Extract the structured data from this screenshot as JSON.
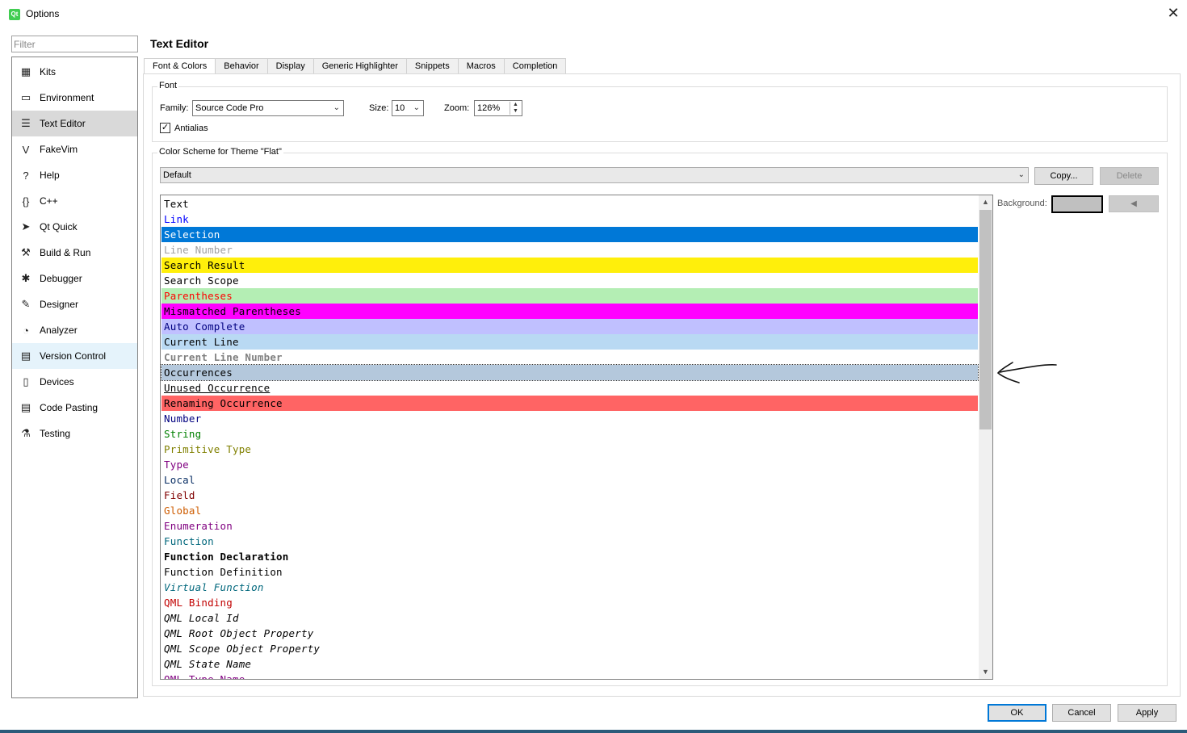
{
  "window": {
    "title": "Options",
    "app_icon_text": "Qt",
    "close_glyph": "✕"
  },
  "filter": {
    "placeholder": "Filter"
  },
  "sidebar": {
    "items": [
      {
        "label": "Kits",
        "icon": "kits-icon",
        "glyph": "▦"
      },
      {
        "label": "Environment",
        "icon": "monitor-icon",
        "glyph": "▭"
      },
      {
        "label": "Text Editor",
        "icon": "text-editor-icon",
        "glyph": "☰",
        "selected": true
      },
      {
        "label": "FakeVim",
        "icon": "fakevim-icon",
        "glyph": "V"
      },
      {
        "label": "Help",
        "icon": "help-icon",
        "glyph": "?"
      },
      {
        "label": "C++",
        "icon": "braces-icon",
        "glyph": "{}"
      },
      {
        "label": "Qt Quick",
        "icon": "paper-plane-icon",
        "glyph": "➤"
      },
      {
        "label": "Build & Run",
        "icon": "hammer-icon",
        "glyph": "⚒"
      },
      {
        "label": "Debugger",
        "icon": "bug-icon",
        "glyph": "✱"
      },
      {
        "label": "Designer",
        "icon": "pen-icon",
        "glyph": "✎"
      },
      {
        "label": "Analyzer",
        "icon": "analyzer-icon",
        "glyph": "◔"
      },
      {
        "label": "Version Control",
        "icon": "version-control-icon",
        "glyph": "▤",
        "hover": true
      },
      {
        "label": "Devices",
        "icon": "devices-icon",
        "glyph": "▯"
      },
      {
        "label": "Code Pasting",
        "icon": "code-pasting-icon",
        "glyph": "▤"
      },
      {
        "label": "Testing",
        "icon": "testing-icon",
        "glyph": "⚗"
      }
    ]
  },
  "page": {
    "title": "Text Editor"
  },
  "tabs": [
    {
      "label": "Font & Colors",
      "active": true
    },
    {
      "label": "Behavior"
    },
    {
      "label": "Display"
    },
    {
      "label": "Generic Highlighter"
    },
    {
      "label": "Snippets"
    },
    {
      "label": "Macros"
    },
    {
      "label": "Completion"
    }
  ],
  "font_group": {
    "title": "Font",
    "family_label": "Family:",
    "family_value": "Source Code Pro",
    "size_label": "Size:",
    "size_value": "10",
    "zoom_label": "Zoom:",
    "zoom_value": "126%",
    "antialias_label": "Antialias",
    "antialias_checked": true
  },
  "scheme_group": {
    "title": "Color Scheme for Theme \"Flat\"",
    "scheme_value": "Default",
    "copy_label": "Copy...",
    "delete_label": "Delete",
    "background_label": "Background:",
    "background_color": "#c0c0c0"
  },
  "scheme_items": [
    {
      "label": "Text",
      "fg": "#000000"
    },
    {
      "label": "Link",
      "fg": "#0000ff"
    },
    {
      "label": "Selection",
      "fg": "#ffffff",
      "bg": "#0078d7"
    },
    {
      "label": "Line Number",
      "fg": "#a0a0a0"
    },
    {
      "label": "Search Result",
      "fg": "#000000",
      "bg": "#ffef0b"
    },
    {
      "label": "Search Scope",
      "fg": "#000000"
    },
    {
      "label": "Parentheses",
      "fg": "#ff0000",
      "bg": "#b4eeb4"
    },
    {
      "label": "Mismatched Parentheses",
      "fg": "#000000",
      "bg": "#ff00ff"
    },
    {
      "label": "Auto Complete",
      "fg": "#000080",
      "bg": "#c0c0ff"
    },
    {
      "label": "Current Line",
      "fg": "#000000",
      "bg": "#b9d9f3"
    },
    {
      "label": "Current Line Number",
      "fg": "#808080",
      "bold": true
    },
    {
      "label": "Occurrences",
      "fg": "#000000",
      "bg": "#b4c8dc",
      "outlined": true
    },
    {
      "label": "Unused Occurrence",
      "fg": "#000000",
      "underline": true
    },
    {
      "label": "Renaming Occurrence",
      "fg": "#000000",
      "bg": "#ff6464"
    },
    {
      "label": "Number",
      "fg": "#000080"
    },
    {
      "label": "String",
      "fg": "#008000"
    },
    {
      "label": "Primitive Type",
      "fg": "#808000"
    },
    {
      "label": "Type",
      "fg": "#800080"
    },
    {
      "label": "Local",
      "fg": "#092e64"
    },
    {
      "label": "Field",
      "fg": "#800000"
    },
    {
      "label": "Global",
      "fg": "#ce5c00"
    },
    {
      "label": "Enumeration",
      "fg": "#800080"
    },
    {
      "label": "Function",
      "fg": "#00677c"
    },
    {
      "label": "Function Declaration",
      "fg": "#000000",
      "bold": true
    },
    {
      "label": "Function Definition",
      "fg": "#000000"
    },
    {
      "label": "Virtual Function",
      "fg": "#00677c",
      "italic": true
    },
    {
      "label": "QML Binding",
      "fg": "#c10000"
    },
    {
      "label": "QML Local Id",
      "fg": "#000000",
      "italic": true
    },
    {
      "label": "QML Root Object Property",
      "fg": "#000000",
      "italic": true
    },
    {
      "label": "QML Scope Object Property",
      "fg": "#000000",
      "italic": true
    },
    {
      "label": "QML State Name",
      "fg": "#000000",
      "italic": true
    },
    {
      "label": "QML Type Name",
      "fg": "#800080"
    }
  ],
  "scrollbar": {
    "up_glyph": "▲",
    "down_glyph": "▼"
  },
  "footer": {
    "ok_label": "OK",
    "cancel_label": "Cancel",
    "apply_label": "Apply"
  },
  "colors": {
    "accent": "#0078d7",
    "selected_nav": "#d9d9d9",
    "hover_nav": "#e5f3fb"
  }
}
